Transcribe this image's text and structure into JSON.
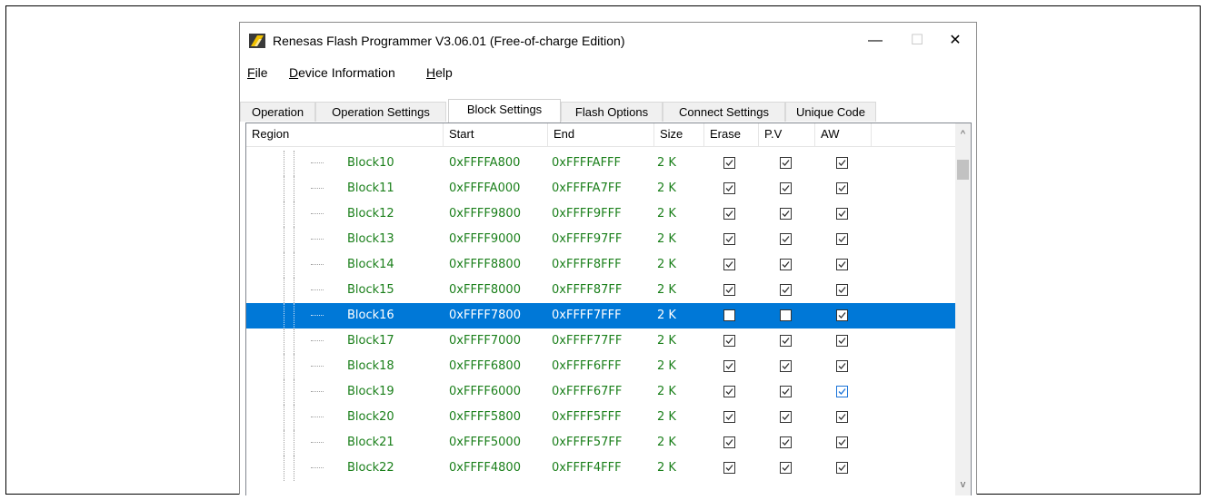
{
  "window": {
    "title": "Renesas Flash Programmer V3.06.01  (Free-of-charge Edition)",
    "minimize_glyph": "—",
    "maximize_glyph": "☐",
    "close_glyph": "✕"
  },
  "menu": {
    "items": [
      {
        "accel": "F",
        "rest": "ile"
      },
      {
        "accel": "D",
        "rest": "evice Information"
      },
      {
        "accel": "H",
        "rest": "elp"
      }
    ]
  },
  "tabs": [
    {
      "label": "Operation",
      "active": false
    },
    {
      "label": "Operation Settings",
      "active": false
    },
    {
      "label": "Block Settings",
      "active": true
    },
    {
      "label": "Flash Options",
      "active": false
    },
    {
      "label": "Connect Settings",
      "active": false
    },
    {
      "label": "Unique Code",
      "active": false
    }
  ],
  "table": {
    "columns": [
      "Region",
      "Start",
      "End",
      "Size",
      "Erase",
      "P.V",
      "AW"
    ],
    "rows": [
      {
        "name": "Block10",
        "start": "0xFFFFA800",
        "end": "0xFFFFAFFF",
        "size": "2 K",
        "erase": true,
        "pv": true,
        "aw": true,
        "selected": false
      },
      {
        "name": "Block11",
        "start": "0xFFFFA000",
        "end": "0xFFFFA7FF",
        "size": "2 K",
        "erase": true,
        "pv": true,
        "aw": true,
        "selected": false
      },
      {
        "name": "Block12",
        "start": "0xFFFF9800",
        "end": "0xFFFF9FFF",
        "size": "2 K",
        "erase": true,
        "pv": true,
        "aw": true,
        "selected": false
      },
      {
        "name": "Block13",
        "start": "0xFFFF9000",
        "end": "0xFFFF97FF",
        "size": "2 K",
        "erase": true,
        "pv": true,
        "aw": true,
        "selected": false
      },
      {
        "name": "Block14",
        "start": "0xFFFF8800",
        "end": "0xFFFF8FFF",
        "size": "2 K",
        "erase": true,
        "pv": true,
        "aw": true,
        "selected": false
      },
      {
        "name": "Block15",
        "start": "0xFFFF8000",
        "end": "0xFFFF87FF",
        "size": "2 K",
        "erase": true,
        "pv": true,
        "aw": true,
        "selected": false
      },
      {
        "name": "Block16",
        "start": "0xFFFF7800",
        "end": "0xFFFF7FFF",
        "size": "2 K",
        "erase": false,
        "pv": false,
        "aw": true,
        "selected": true
      },
      {
        "name": "Block17",
        "start": "0xFFFF7000",
        "end": "0xFFFF77FF",
        "size": "2 K",
        "erase": true,
        "pv": true,
        "aw": true,
        "selected": false
      },
      {
        "name": "Block18",
        "start": "0xFFFF6800",
        "end": "0xFFFF6FFF",
        "size": "2 K",
        "erase": true,
        "pv": true,
        "aw": true,
        "selected": false
      },
      {
        "name": "Block19",
        "start": "0xFFFF6000",
        "end": "0xFFFF67FF",
        "size": "2 K",
        "erase": true,
        "pv": true,
        "aw": true,
        "selected": false,
        "aw_hover": true
      },
      {
        "name": "Block20",
        "start": "0xFFFF5800",
        "end": "0xFFFF5FFF",
        "size": "2 K",
        "erase": true,
        "pv": true,
        "aw": true,
        "selected": false
      },
      {
        "name": "Block21",
        "start": "0xFFFF5000",
        "end": "0xFFFF57FF",
        "size": "2 K",
        "erase": true,
        "pv": true,
        "aw": true,
        "selected": false
      },
      {
        "name": "Block22",
        "start": "0xFFFF4800",
        "end": "0xFFFF4FFF",
        "size": "2 K",
        "erase": true,
        "pv": true,
        "aw": true,
        "selected": false
      }
    ]
  },
  "scrollbar": {
    "up_glyph": "^",
    "down_glyph": "v"
  },
  "colors": {
    "selection": "#0078d7",
    "row_text": "#1a7f1a",
    "hover_check": "#1a73d8"
  }
}
